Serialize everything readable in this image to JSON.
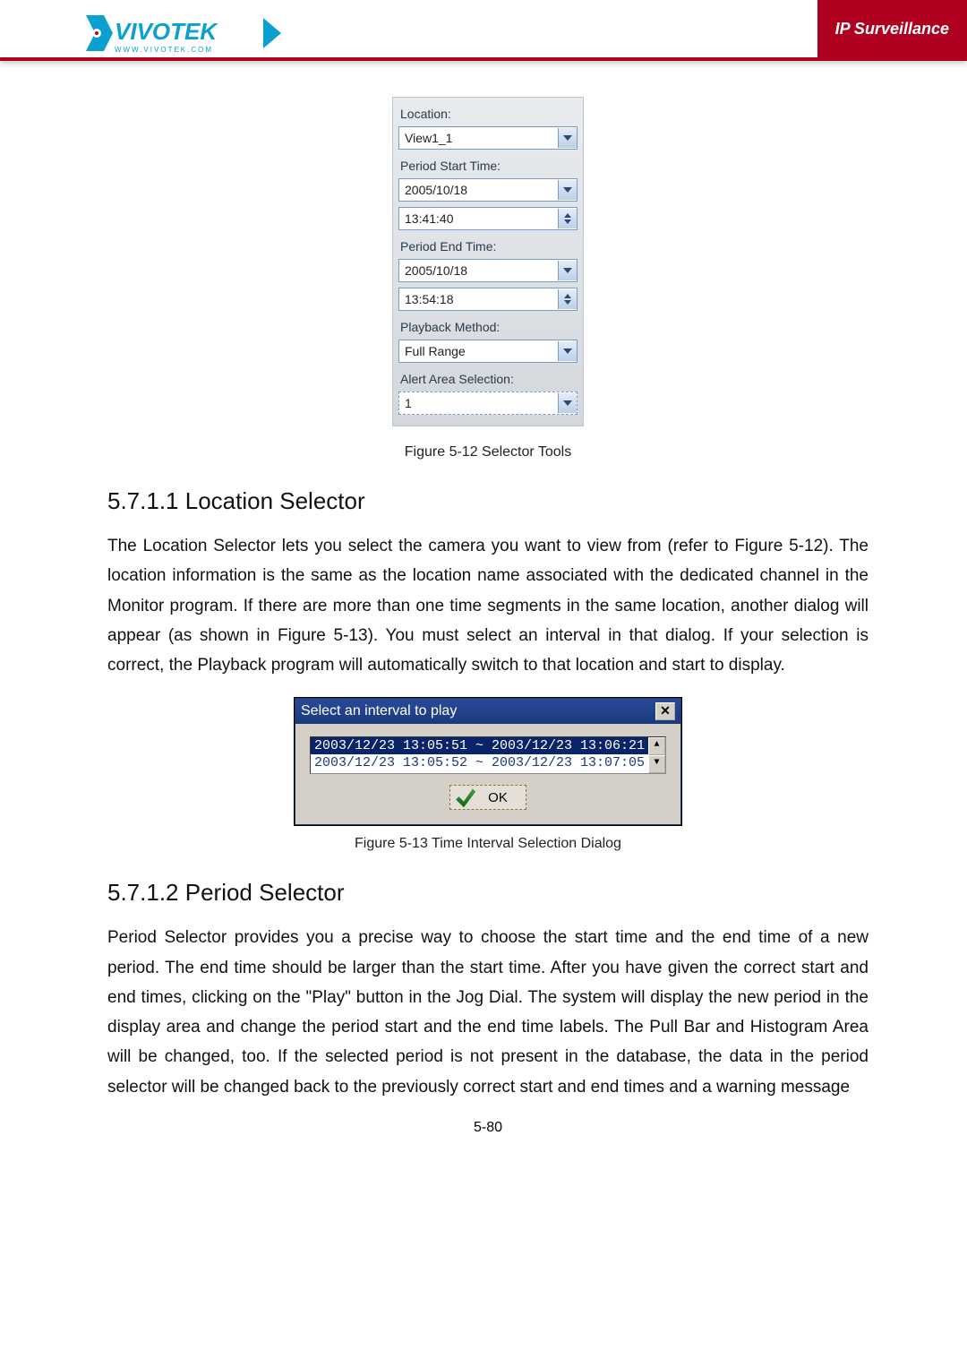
{
  "header": {
    "brand_tag": "IP Surveillance"
  },
  "selector_panel": {
    "location_label": "Location:",
    "location_value": "View1_1",
    "period_start_label": "Period Start Time:",
    "start_date": "2005/10/18",
    "start_time": "13:41:40",
    "period_end_label": "Period End Time:",
    "end_date": "2005/10/18",
    "end_time": "13:54:18",
    "playback_method_label": "Playback Method:",
    "playback_method_value": "Full Range",
    "alert_area_label": "Alert Area Selection:",
    "alert_area_value": "1"
  },
  "captions": {
    "fig_5_12": "Figure 5-12 Selector Tools",
    "fig_5_13": "Figure 5-13 Time Interval Selection Dialog"
  },
  "sections": {
    "s1_heading": "5.7.1.1  Location Selector",
    "s1_body": "The Location Selector lets you select the camera you want to view from (refer to Figure 5-12). The location information is the same as the location name associated with the dedicated channel in the Monitor program. If there are more than one time segments in the same location, another dialog will appear (as shown in Figure 5-13). You must select an interval in that dialog. If your selection is correct, the Playback program will automatically switch to that location and start to display.",
    "s2_heading": "5.7.1.2  Period Selector",
    "s2_body": "Period Selector provides you a precise way to choose the start time and the end time of a new period. The end time should be larger than the start time. After you have given the correct start and end times, clicking on the \"Play\" button in the Jog Dial. The system will display the new period in the display area and change the period start and the end time labels. The Pull Bar and Histogram Area will be changed, too. If the selected period is not present in the database, the data in the period selector will be changed back to the previously correct start and end times and a warning message"
  },
  "dialog": {
    "title": "Select an interval to play",
    "line1": "2003/12/23 13:05:51 ~ 2003/12/23 13:06:21",
    "line2": "2003/12/23 13:05:52 ~ 2003/12/23 13:07:05",
    "ok_label": "OK"
  },
  "page_number": "5-80"
}
